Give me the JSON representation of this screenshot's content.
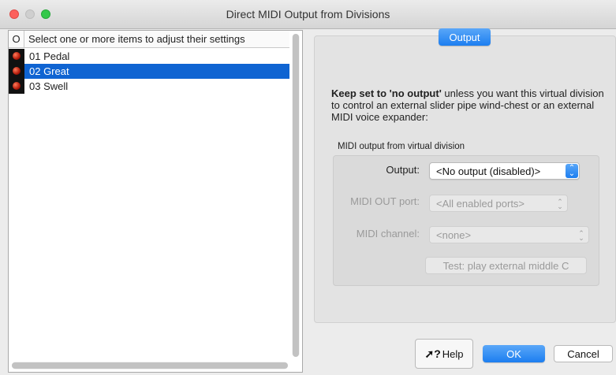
{
  "window": {
    "title": "Direct MIDI Output from Divisions"
  },
  "list": {
    "column_o": "O",
    "column_name": "Select one or more items to adjust their settings",
    "items": [
      {
        "label": "01 Pedal",
        "selected": false
      },
      {
        "label": "02 Great",
        "selected": true
      },
      {
        "label": "03 Swell",
        "selected": false
      }
    ]
  },
  "tab": {
    "label": "Output"
  },
  "info": {
    "bold": "Keep set to 'no output'",
    "rest": " unless you want this virtual division to control an external slider pipe wind-chest or an external MIDI voice expander:"
  },
  "section": {
    "label": "MIDI output from virtual division",
    "output_label": "Output:",
    "output_value": "<No output (disabled)>",
    "port_label": "MIDI OUT port:",
    "port_value": "<All enabled ports>",
    "channel_label": "MIDI channel:",
    "channel_value": "<none>",
    "test_label": "Test: play external middle C"
  },
  "buttons": {
    "help": "Help",
    "ok": "OK",
    "cancel": "Cancel"
  },
  "colors": {
    "accent": "#1c7ef0",
    "selection": "#0f64d2"
  }
}
